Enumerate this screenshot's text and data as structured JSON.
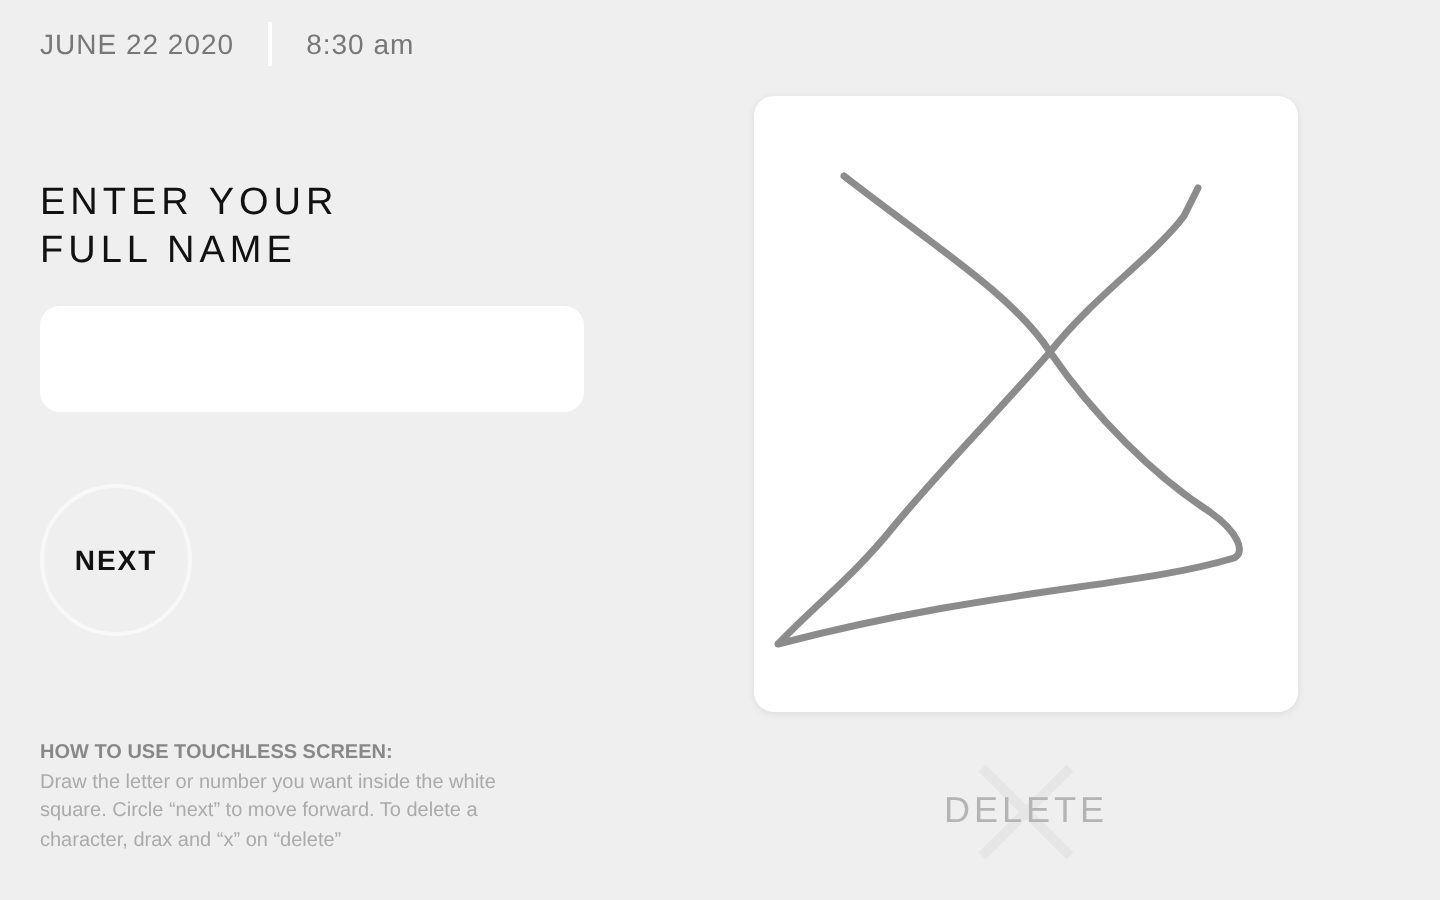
{
  "header": {
    "date": "JUNE 22 2020",
    "time": "8:30 am"
  },
  "name_prompt": {
    "title_lines": [
      "ENTER YOUR",
      "FULL NAME"
    ]
  },
  "next_button": {
    "label": "NEXT"
  },
  "instructions": {
    "heading": "HOW TO USE TOUCHLESS SCREEN:",
    "body": "Draw the letter or number you want inside the white square. Circle “next” to move forward. To delete a character, drax and “x” on “delete”"
  },
  "delete_button": {
    "label": "DELETE",
    "crossed": true
  }
}
